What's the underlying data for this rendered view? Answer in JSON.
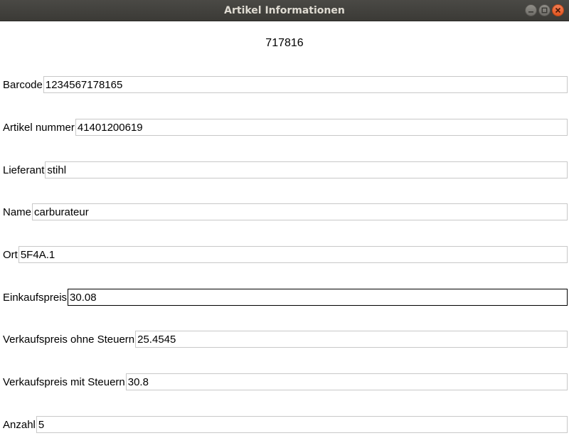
{
  "window": {
    "title": "Artikel Informationen",
    "buttons": {
      "minimize_icon": "minimize-icon",
      "maximize_icon": "maximize-icon",
      "close_icon": "close-icon"
    }
  },
  "article_id": "717816",
  "fields": {
    "barcode": {
      "label": "Barcode",
      "value": "1234567178165"
    },
    "artikel_nummer": {
      "label": "Artikel nummer",
      "value": "41401200619"
    },
    "lieferant": {
      "label": "Lieferant",
      "value": "stihl"
    },
    "name": {
      "label": "Name",
      "value": "carburateur"
    },
    "ort": {
      "label": "Ort",
      "value": "5F4A.1"
    },
    "einkaufspreis": {
      "label": "Einkaufspreis",
      "value": "30.08"
    },
    "verkaufspreis_ohne": {
      "label": "Verkaufspreis ohne Steuern",
      "value": "25.4545"
    },
    "verkaufspreis_mit": {
      "label": "Verkaufspreis mit Steuern",
      "value": "30.8"
    },
    "anzahl": {
      "label": "Anzahl",
      "value": "5"
    }
  },
  "colors": {
    "titlebar": "#3b3a36",
    "close_button": "#e2561f",
    "focused_border": "#000000",
    "field_border": "#c8c8c8"
  }
}
